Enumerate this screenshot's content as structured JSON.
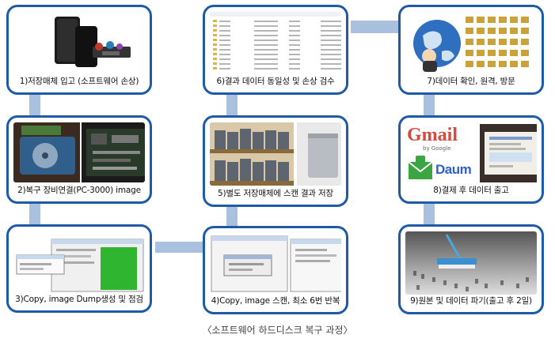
{
  "steps": [
    {
      "label": "1)저장매체 입고 (소프트웨어 손상)",
      "icon": "hard-drive-icon"
    },
    {
      "label": "2)복구 장비연결(PC-3000)  image",
      "icon": "circuit-board-icon"
    },
    {
      "label": "3)Copy, image Dump생성 및 점검",
      "icon": "software-window-icon"
    },
    {
      "label": "4)Copy, image 스캔, 최소 6번 반복",
      "icon": "software-window-icon"
    },
    {
      "label": "5)별도 저장매체에 스캔 결과 저장",
      "icon": "storage-shelf-icon"
    },
    {
      "label": "6)결과 데이터 동일성 및 손상 검수",
      "icon": "file-list-icon"
    },
    {
      "label": "7)데이터 확인, 원격, 방문",
      "icon": "globe-icon"
    },
    {
      "label": "8)결제 후 데이터 출고",
      "icon": "mail-logos-icon"
    },
    {
      "label": "9)원본 및 데이터 파기(출고 후 2일)",
      "icon": "binary-sweep-icon"
    }
  ],
  "logos": {
    "gmail": "Gmail",
    "google_sub": "by Google",
    "daum": "Daum"
  },
  "caption": "〈소프트웨어 하드디스크 복구 과정〉",
  "colors": {
    "card_border": "#1f5aa6",
    "connector": "#a9c1de",
    "gmail_green": "#3aa541"
  }
}
